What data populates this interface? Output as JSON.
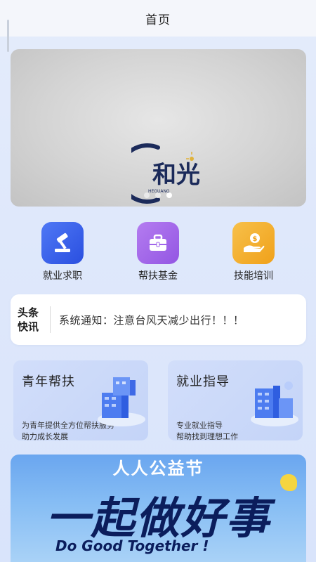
{
  "header": {
    "title": "首页"
  },
  "banner": {
    "logo_text": "和光",
    "logo_sub": "HEGUANG",
    "dots": 3,
    "active_dot": 3
  },
  "quick": [
    {
      "label": "就业求职",
      "icon": "gavel-icon",
      "color": "#3d63ee"
    },
    {
      "label": "帮扶基金",
      "icon": "briefcase-icon",
      "color": "#a368ea"
    },
    {
      "label": "技能培训",
      "icon": "money-hand-icon",
      "color": "#f2ac28"
    }
  ],
  "news": {
    "tag_line1": "头条",
    "tag_line2": "快讯",
    "text": "系统通知：注意台风天减少出行！！！"
  },
  "cards": [
    {
      "title": "青年帮扶",
      "desc1": "为青年提供全方位帮扶服务",
      "desc2": "助力成长发展"
    },
    {
      "title": "就业指导",
      "desc1": "专业就业指导",
      "desc2": "帮助找到理想工作"
    }
  ],
  "promo": {
    "title": "人人公益节",
    "main": "一起做好事",
    "sub": "Do Good Together !"
  },
  "colors": {
    "accent": "#3d63ee",
    "background": "#dfe8fb"
  }
}
